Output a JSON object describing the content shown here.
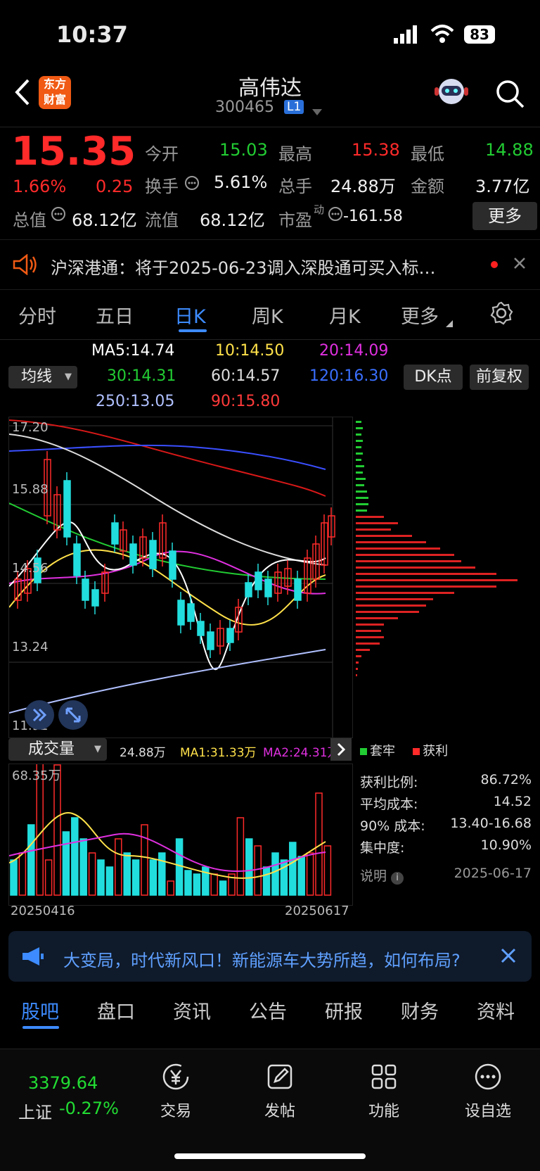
{
  "status": {
    "time": "10:37",
    "battery": "83"
  },
  "header": {
    "title": "高伟达",
    "code": "300465",
    "level": "L1",
    "logo_line1": "东方",
    "logo_line2": "财富"
  },
  "quote": {
    "price": "15.35",
    "change_pct": "1.66%",
    "change": "0.25",
    "open_label": "今开",
    "open": "15.03",
    "high_label": "最高",
    "high": "15.38",
    "low_label": "最低",
    "low": "14.88",
    "turnover_label": "换手",
    "turnover": "5.61%",
    "volume_label": "总手",
    "volume": "24.88万",
    "amount_label": "金额",
    "amount": "3.77亿",
    "mktcap_label": "总值",
    "mktcap": "68.12亿",
    "float_label": "流值",
    "float": "68.12亿",
    "pe_label": "市盈",
    "pe_sup": "动",
    "pe": "-161.58",
    "more_label": "更多"
  },
  "notice": {
    "text": "沪深港通：将于2025-06-23调入深股通可买入标…"
  },
  "tabs": [
    "分时",
    "五日",
    "日K",
    "周K",
    "月K",
    "更多"
  ],
  "active_tab": 2,
  "ma": {
    "selector": "均线",
    "ma5": "MA5:14.74",
    "ma10": "10:14.50",
    "ma20": "20:14.09",
    "ma30": "30:14.31",
    "ma60": "60:14.57",
    "ma120": "120:16.30",
    "ma250": "250:13.05",
    "ma90": "90:15.80",
    "dk_label": "DK点",
    "fq_label": "前复权"
  },
  "colors": {
    "up": "#ff2a2a",
    "down": "#22dddd",
    "ma5": "#ffffff",
    "ma10": "#ffe14a",
    "ma20": "#e030e0",
    "ma30": "#22cc33",
    "ma60": "#dddddd",
    "ma120": "#3a4fff",
    "ma250": "#b0c0ff",
    "ma90": "#d81818",
    "accent": "#3d8bff"
  },
  "chart_data": {
    "type": "candlestick",
    "ylim": [
      11.92,
      17.2
    ],
    "y_ticks": [
      "17.20",
      "15.88",
      "14.56",
      "13.24",
      "11.92"
    ],
    "x_labels": [
      "20250416",
      "20250617"
    ],
    "volume_max_label": "68.35万",
    "volume_selector": "成交量",
    "volume_value": "24.88万",
    "vol_ma1": "MA1:31.33万",
    "vol_ma2": "MA2:24.31万"
  },
  "chips": {
    "legend_trapped": "套牢",
    "legend_profit": "获利",
    "rows": [
      {
        "label": "获利比例:",
        "value": "86.72%"
      },
      {
        "label": "平均成本:",
        "value": "14.52"
      },
      {
        "label": "90% 成本:",
        "value": "13.40-16.68"
      },
      {
        "label": "集中度:",
        "value": "10.90%"
      }
    ],
    "note_label": "说明",
    "date": "2025-06-17"
  },
  "ad": {
    "text": "大变局，时代新风口！新能源车大势所趋，如何布局?"
  },
  "bottom_tabs": [
    "股吧",
    "盘口",
    "资讯",
    "公告",
    "研报",
    "财务",
    "资料"
  ],
  "ticker": {
    "value": "3379.64",
    "name": "上证",
    "change": "-0.27%"
  },
  "bottom_nav": [
    "交易",
    "发帖",
    "功能",
    "设自选"
  ]
}
